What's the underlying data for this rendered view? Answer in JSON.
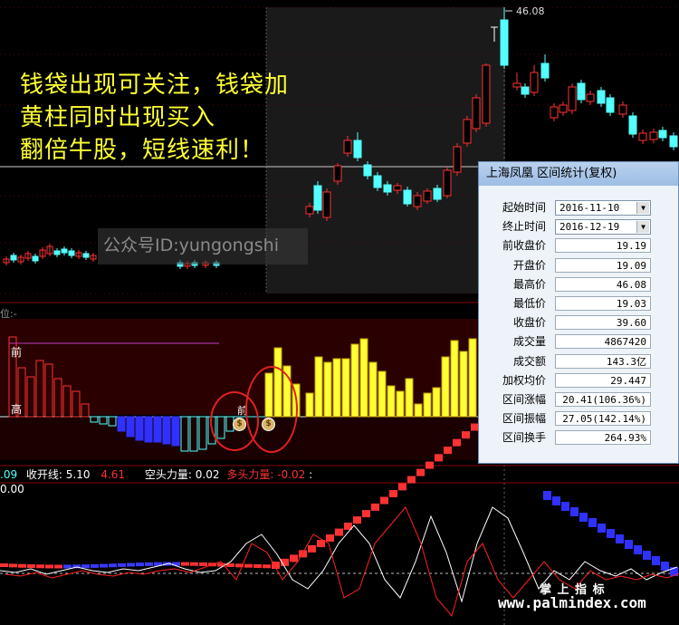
{
  "caption": {
    "line1": "钱袋出现可关注，钱袋加",
    "line2": "黄柱同时出现买入",
    "line3": "翻倍牛股，短线速利！"
  },
  "watermark": "公众号ID:yungongshi",
  "price_high_label": "46.08",
  "mid_panel_label": "位:-",
  "mid_panel_marks": {
    "front": "前",
    "high": "高",
    "front2": "前"
  },
  "indicator_line": {
    "v1": ".09",
    "label1": "收开线:",
    "v2": "5.10",
    "v3": "4.61",
    "label2": "空头力量:",
    "v4": "0.02",
    "label3": "多头力量:",
    "v5": "-0.02",
    "v6": ": 0.00"
  },
  "money_bag_glyph": "$",
  "dialog": {
    "title": "上海凤凰 区间统计(复权)",
    "dropdown_glyph": "▼",
    "rows": [
      {
        "label": "起始时间",
        "value": "2016-11-10",
        "select": true
      },
      {
        "label": "终止时间",
        "value": "2016-12-19",
        "select": true
      },
      {
        "label": "前收盘价",
        "value": "19.19"
      },
      {
        "label": "开盘价",
        "value": "19.09"
      },
      {
        "label": "最高价",
        "value": "46.08"
      },
      {
        "label": "最低价",
        "value": "19.03"
      },
      {
        "label": "收盘价",
        "value": "39.60"
      },
      {
        "label": "成交量",
        "value": "4867420"
      },
      {
        "label": "成交额",
        "value": "143.3亿"
      },
      {
        "label": "加权均价",
        "value": "29.447"
      },
      {
        "label": "区间涨幅",
        "value": "20.41(106.36%)"
      },
      {
        "label": "区间振幅",
        "value": "27.05(142.14%)"
      },
      {
        "label": "区间换手",
        "value": "264.93%"
      }
    ]
  },
  "footer": {
    "brand": "掌 上 指 标",
    "url": "www.palmindex.com"
  },
  "colors": {
    "up": "#ff3232",
    "down": "#54ffff",
    "yellow": "#ffff33",
    "blue": "#3030ff",
    "accent_red": "#e02020",
    "magenta": "#c03cc0"
  }
}
